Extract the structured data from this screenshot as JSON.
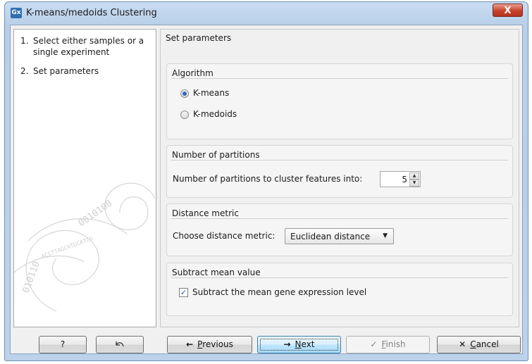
{
  "window": {
    "app_icon": "Gx",
    "title": "K-means/medoids Clustering",
    "close_glyph": "X"
  },
  "steps": [
    {
      "num": "1.",
      "label": "Select either samples or a single experiment"
    },
    {
      "num": "2.",
      "label": "Set parameters"
    }
  ],
  "main": {
    "title": "Set parameters",
    "algorithm": {
      "title": "Algorithm",
      "options": [
        {
          "label": "K-means",
          "selected": true
        },
        {
          "label": "K-medoids",
          "selected": false
        }
      ]
    },
    "partitions": {
      "title": "Number of partitions",
      "label": "Number of partitions to cluster features into:",
      "value": "5"
    },
    "distance": {
      "title": "Distance metric",
      "label": "Choose distance metric:",
      "value": "Euclidean distance"
    },
    "subtract": {
      "title": "Subtract mean value",
      "checkbox_label": "Subtract the mean gene expression level",
      "checked": true
    }
  },
  "buttons": {
    "help": "?",
    "reset_icon": "undo-arrow-icon",
    "previous": "Previous",
    "previous_mnemonic": "P",
    "next": "Next",
    "next_mnemonic": "N",
    "finish": "Finish",
    "finish_mnemonic": "F",
    "cancel": "Cancel",
    "cancel_mnemonic": "C"
  },
  "colors": {
    "title_bar": "#c9dcf2",
    "close_button": "#c7412b",
    "dialog_bg": "#f0f0f0",
    "default_button": "#bee6fd",
    "radio_dot": "#2e69b6"
  }
}
